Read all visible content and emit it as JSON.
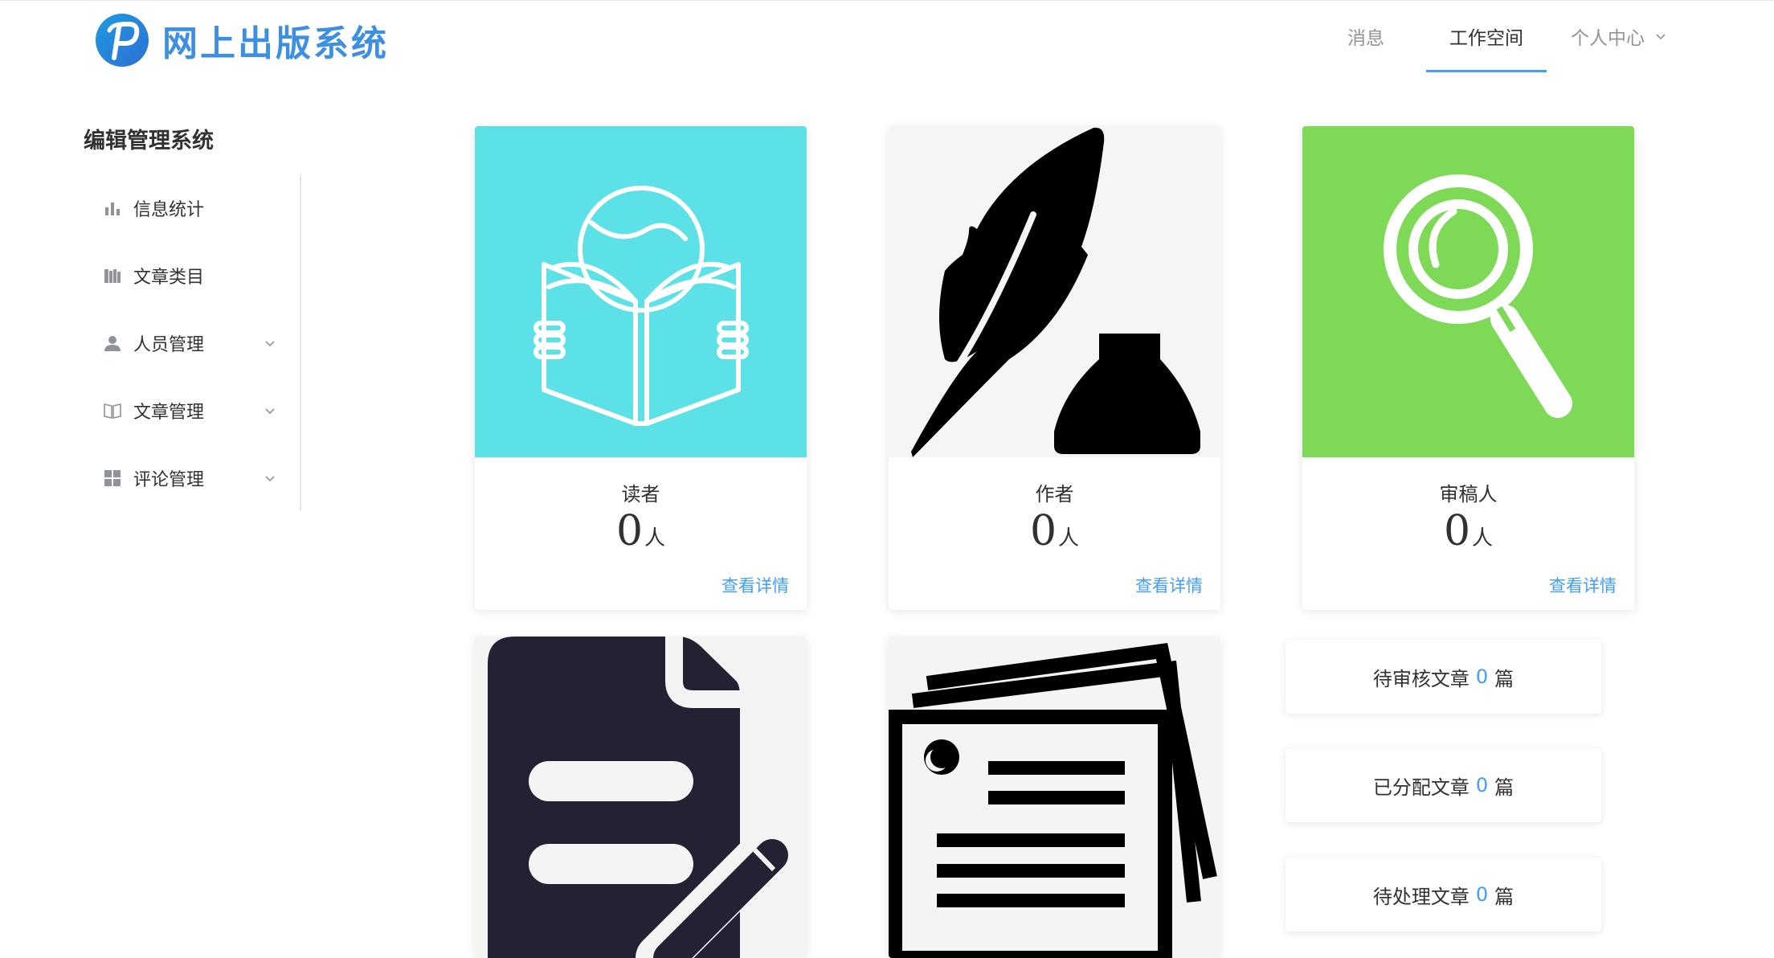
{
  "header": {
    "logo_text": "网上出版系统",
    "nav": {
      "messages": "消息",
      "workspace": "工作空间",
      "personal_center": "个人中心"
    }
  },
  "sidebar": {
    "title": "编辑管理系统",
    "items": [
      {
        "label": "信息统计",
        "icon": "bar-chart-icon",
        "has_submenu": false
      },
      {
        "label": "文章类目",
        "icon": "books-icon",
        "has_submenu": false
      },
      {
        "label": "人员管理",
        "icon": "user-icon",
        "has_submenu": true
      },
      {
        "label": "文章管理",
        "icon": "open-book-icon",
        "has_submenu": true
      },
      {
        "label": "评论管理",
        "icon": "grid-icon",
        "has_submenu": true
      }
    ]
  },
  "cards": [
    {
      "label": "读者",
      "count": "0",
      "unit": "人",
      "link": "查看详情",
      "bg": "#5ce1e6",
      "icon": "reader-icon"
    },
    {
      "label": "作者",
      "count": "0",
      "unit": "人",
      "link": "查看详情",
      "bg": "#f5f5f5",
      "icon": "quill-ink-icon"
    },
    {
      "label": "审稿人",
      "count": "0",
      "unit": "人",
      "link": "查看详情",
      "bg": "#7ed957",
      "icon": "magnifier-icon"
    }
  ],
  "tiles": [
    {
      "icon": "document-edit-icon",
      "bg": "#f4f4f4"
    },
    {
      "icon": "papers-stack-icon",
      "bg": "#f4f4f4"
    }
  ],
  "stats": [
    {
      "prefix": "待审核文章",
      "count": "0",
      "suffix": "篇"
    },
    {
      "prefix": "已分配文章",
      "count": "0",
      "suffix": "篇"
    },
    {
      "prefix": "待处理文章",
      "count": "0",
      "suffix": "篇"
    }
  ],
  "colors": {
    "accent": "#409eff",
    "logo": "#3d8fe0"
  }
}
